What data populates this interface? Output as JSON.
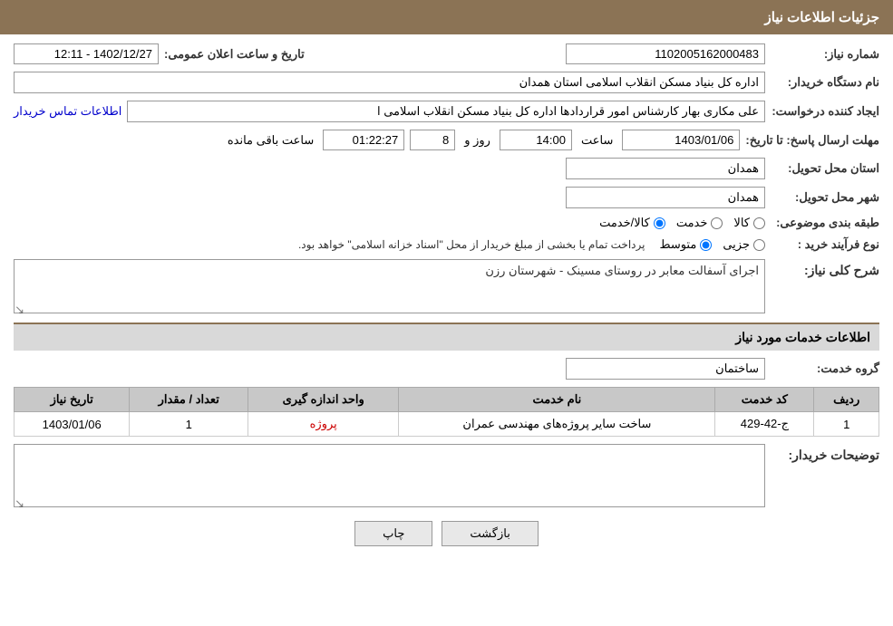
{
  "header": {
    "title": "جزئیات اطلاعات نیاز"
  },
  "fields": {
    "need_number_label": "شماره نیاز:",
    "need_number_value": "1102005162000483",
    "public_date_label": "تاریخ و ساعت اعلان عمومی:",
    "public_date_value": "1402/12/27 - 12:11",
    "buyer_org_label": "نام دستگاه خریدار:",
    "buyer_org_value": "اداره کل بنیاد مسکن انقلاب اسلامی استان همدان",
    "creator_label": "ایجاد کننده درخواست:",
    "creator_value": "علی مکاری بهار کارشناس امور قراردادها اداره کل بنیاد مسکن انقلاب اسلامی ا",
    "creator_link": "اطلاعات تماس خریدار",
    "deadline_label": "مهلت ارسال پاسخ: تا تاریخ:",
    "deadline_date": "1403/01/06",
    "deadline_time_label": "ساعت",
    "deadline_time": "14:00",
    "deadline_days_label": "روز و",
    "deadline_days": "8",
    "deadline_remaining_label": "ساعت باقی مانده",
    "deadline_remaining": "01:22:27",
    "province_label": "استان محل تحویل:",
    "province_value": "همدان",
    "city_label": "شهر محل تحویل:",
    "city_value": "همدان",
    "category_label": "طبقه بندی موضوعی:",
    "category_options": [
      {
        "label": "کالا",
        "value": "kala"
      },
      {
        "label": "خدمت",
        "value": "khedmat"
      },
      {
        "label": "کالا/خدمت",
        "value": "kala_khedmat"
      }
    ],
    "category_selected": "kala_khedmat",
    "purchase_type_label": "نوع فرآیند خرید :",
    "purchase_type_options": [
      {
        "label": "جزیی",
        "value": "jozii"
      },
      {
        "label": "متوسط",
        "value": "motavasset"
      }
    ],
    "purchase_type_selected": "motavasset",
    "purchase_type_note": "پرداخت تمام یا بخشی از مبلغ خریدار از محل \"اسناد خزانه اسلامی\" خواهد بود.",
    "description_label": "شرح کلی نیاز:",
    "description_value": "اجرای آسفالت معابر در روستای مسینک - شهرستان رزن",
    "services_header": "اطلاعات خدمات مورد نیاز",
    "service_group_label": "گروه خدمت:",
    "service_group_value": "ساختمان",
    "table": {
      "columns": [
        {
          "id": "row_num",
          "label": "ردیف"
        },
        {
          "id": "service_code",
          "label": "کد خدمت"
        },
        {
          "id": "service_name",
          "label": "نام خدمت"
        },
        {
          "id": "unit",
          "label": "واحد اندازه گیری"
        },
        {
          "id": "quantity",
          "label": "تعداد / مقدار"
        },
        {
          "id": "date",
          "label": "تاریخ نیاز"
        }
      ],
      "rows": [
        {
          "row_num": "1",
          "service_code": "ج-42-429",
          "service_name": "ساخت سایر پروژه‌های مهندسی عمران",
          "unit": "پروژه",
          "quantity": "1",
          "date": "1403/01/06"
        }
      ]
    },
    "buyer_notes_label": "توضیحات خریدار:",
    "buyer_notes_value": ""
  },
  "buttons": {
    "print_label": "چاپ",
    "back_label": "بازگشت"
  },
  "icons": {
    "resize": "↘"
  }
}
